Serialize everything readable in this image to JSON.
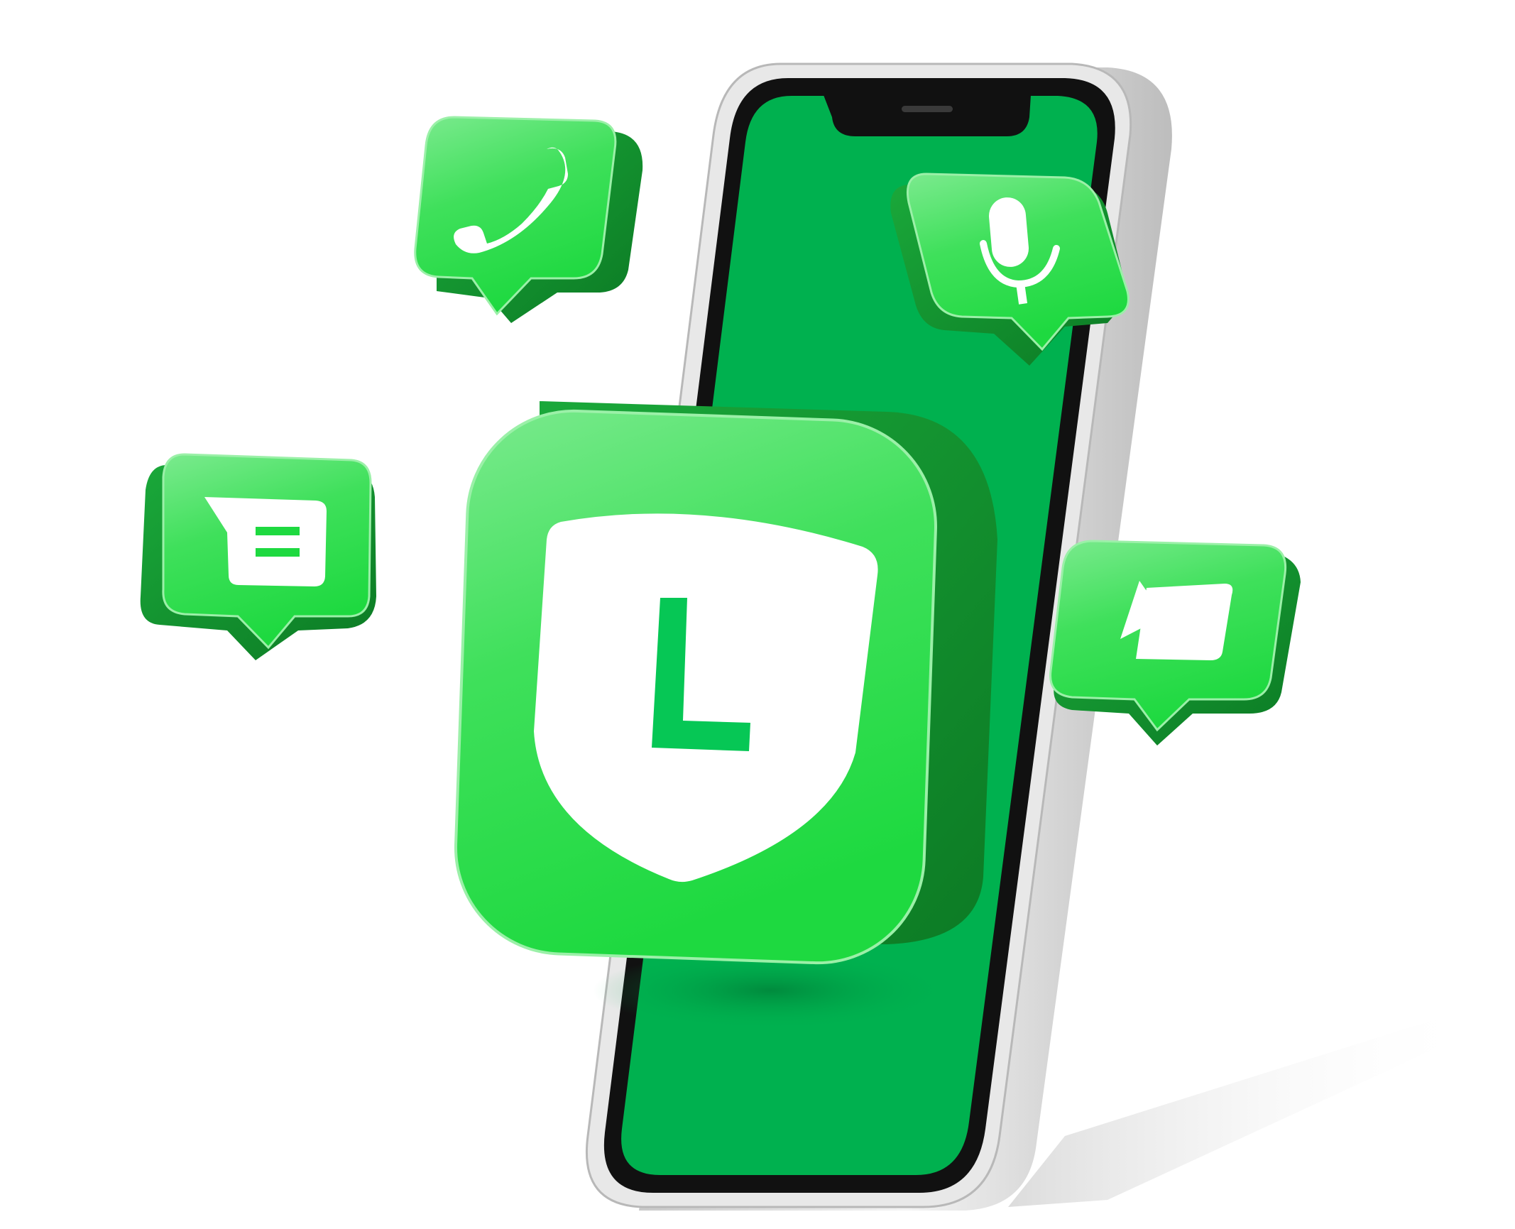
{
  "illustration": {
    "badge_letter": "L",
    "icons": [
      "phone-icon",
      "message-icon",
      "microphone-icon",
      "video-camera-icon",
      "shield-icon"
    ],
    "colors": {
      "brand_green": "#06C755",
      "screen_green": "#00B14F",
      "light_green": "#7BEA8E",
      "bright_green": "#1ED940",
      "dark_green": "#12962E",
      "deep_green": "#0C7A24",
      "phone_frame": "#E4E4E4",
      "phone_bezel": "#111111",
      "shield_white": "#FFFFFF"
    }
  }
}
